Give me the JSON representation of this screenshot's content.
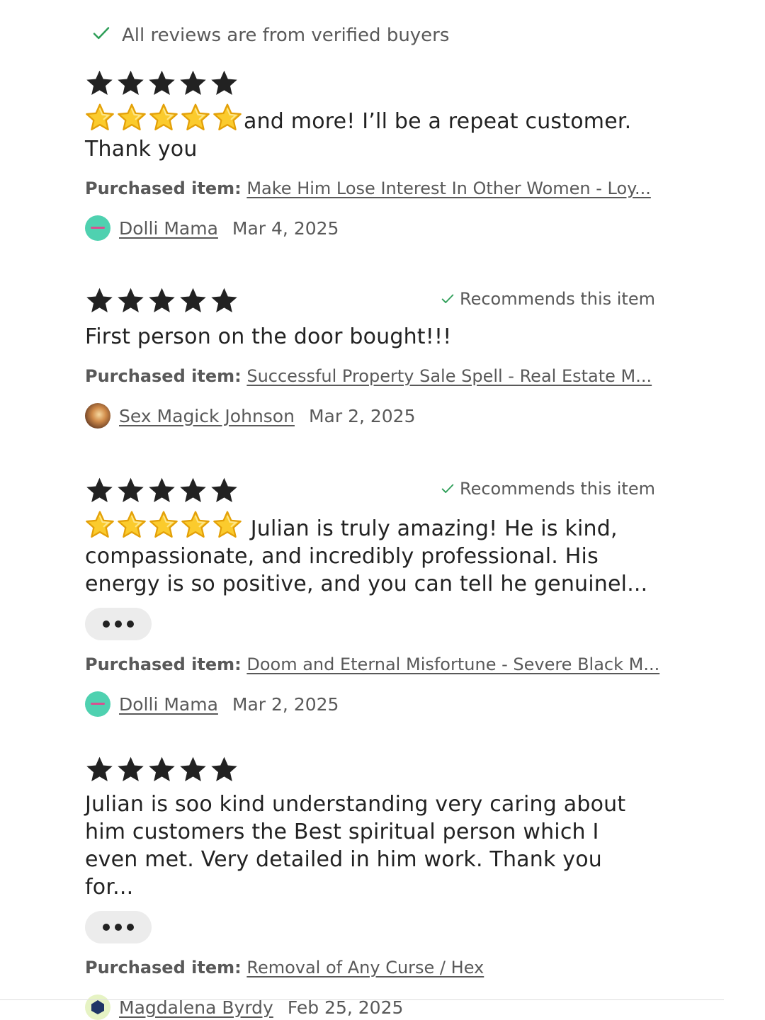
{
  "verified_banner": {
    "icon": "check-icon",
    "text": "All reviews are from verified buyers"
  },
  "recommends_label": "Recommends this item",
  "purchased_label": "Purchased item:",
  "colors": {
    "star": "#222222",
    "emoji_star": "#f9c513",
    "check": "#2e9e58",
    "pill": "#ececec",
    "avatar_dolli": "#4fd1b0"
  },
  "reviews": [
    {
      "rating": 5,
      "text": "and more! I’ll be a repeat customer. Thank you",
      "purchased_item": "Make Him Lose Interest In Other Women - Loy...",
      "reviewer": "Dolli Mama",
      "date": "Mar 4, 2025"
    },
    {
      "rating": 5,
      "recommends": true,
      "text": "First person on the door bought!!!",
      "purchased_item": "Successful Property Sale Spell - Real Estate M...",
      "reviewer": "Sex Magick Johnson",
      "date": "Mar 2, 2025"
    },
    {
      "rating": 5,
      "recommends": true,
      "text": " Julian is truly amazing! He is kind, compassionate, and incredibly professional. His energy is so positive, and you can tell he genuinel...",
      "purchased_item": "Doom and Eternal Misfortune - Severe Black M...",
      "reviewer": "Dolli Mama",
      "date": "Mar 2, 2025"
    },
    {
      "rating": 5,
      "text": "Julian is soo kind understanding very caring about him customers the Best spiritual person which I even met. Very detailed in him work. Thank you for...",
      "purchased_item": "Removal of Any Curse / Hex",
      "reviewer": "Magdalena Byrdy",
      "date": "Feb 25, 2025"
    }
  ]
}
